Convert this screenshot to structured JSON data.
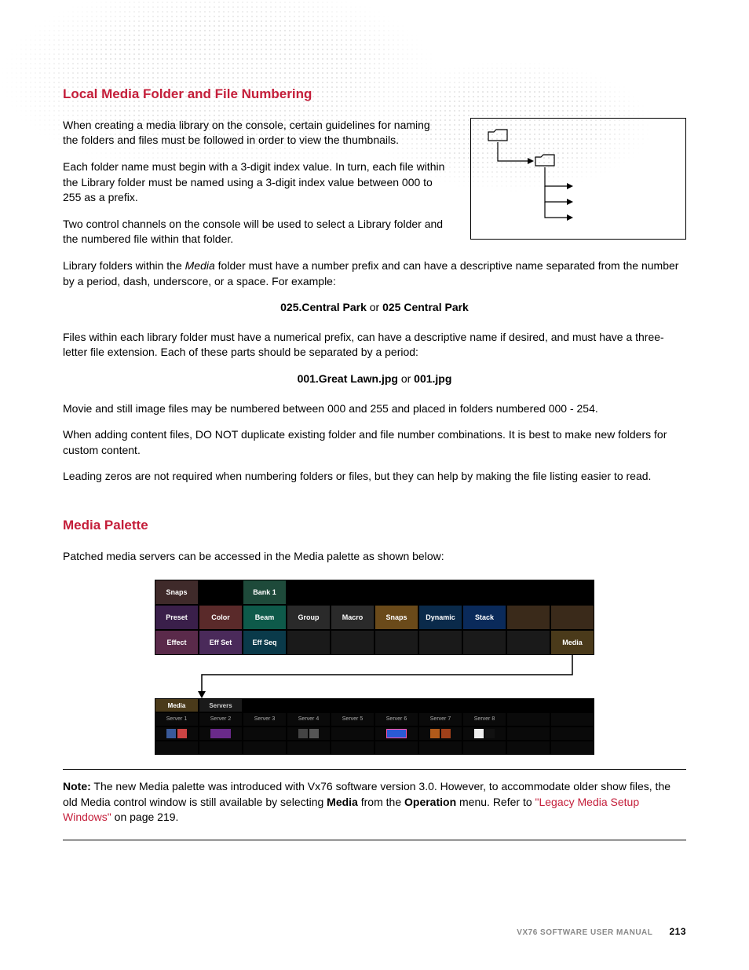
{
  "section1": {
    "heading": "Local Media Folder and File Numbering",
    "p1": "When creating a media library on the console, certain guidelines for naming the folders and files must be followed in order to view the thumbnails.",
    "p2": "Each folder name must begin with a 3-digit index value. In turn, each file within the Library folder must be named using a 3-digit index value between 000 to 255 as a prefix.",
    "p3": "Two control channels on the console will be used to select a Library folder and the numbered file within that folder.",
    "p4a": "Library folders within the ",
    "p4_italic": "Media",
    "p4b": " folder must have a number prefix and can have a descriptive name separated from the number by a period, dash, underscore, or a space. For example:",
    "example1_bold_a": "025.Central Park",
    "example1_mid": " or ",
    "example1_bold_b": "025 Central Park",
    "p5": "Files within each library folder must have a numerical prefix, can have a descriptive name if desired, and must have a three-letter file extension. Each of these parts should be separated by a period:",
    "example2_bold_a": "001.Great Lawn.jpg",
    "example2_mid": " or ",
    "example2_bold_b": "001.jpg",
    "p6": "Movie and still image files may be numbered between 000 and 255 and placed in folders numbered 000 - 254.",
    "p7": "When adding content files, DO NOT duplicate existing folder and file number combinations. It is best to make new folders for custom content.",
    "p8": "Leading zeros are not required when numbering folders or files, but they can help by making the file listing easier to read."
  },
  "section2": {
    "heading": "Media Palette",
    "p1": "Patched media servers can be accessed in the Media palette as shown below:"
  },
  "palette": {
    "row0": {
      "snaps": "Snaps",
      "bank": "Bank 1"
    },
    "row1": {
      "preset": "Preset",
      "color": "Color",
      "beam": "Beam",
      "group": "Group",
      "macro": "Macro",
      "snaps": "Snaps",
      "dynamic": "Dynamic",
      "stack": "Stack"
    },
    "row2": {
      "effect": "Effect",
      "effset": "Eff Set",
      "effseq": "Eff Seq",
      "media": "Media"
    }
  },
  "servers": {
    "mediahdr": "Media",
    "servershdr": "Servers",
    "labels": [
      "Server 1",
      "Server 2",
      "Server 3",
      "Server 4",
      "Server 5",
      "Server 6",
      "Server 7",
      "Server 8"
    ]
  },
  "note": {
    "label": "Note:",
    "body_a": "  The new Media palette was introduced with Vx76 software version 3.0. However, to accommodate older show files, the old Media control window is still available by selecting ",
    "bold1": "Media",
    "body_b": " from the ",
    "bold2": "Operation",
    "body_c": " menu. Refer to ",
    "link": "\"Legacy Media Setup Windows\"",
    "body_d": " on page 219."
  },
  "footer": {
    "text": "VX76 SOFTWARE USER MANUAL",
    "page": "213"
  }
}
